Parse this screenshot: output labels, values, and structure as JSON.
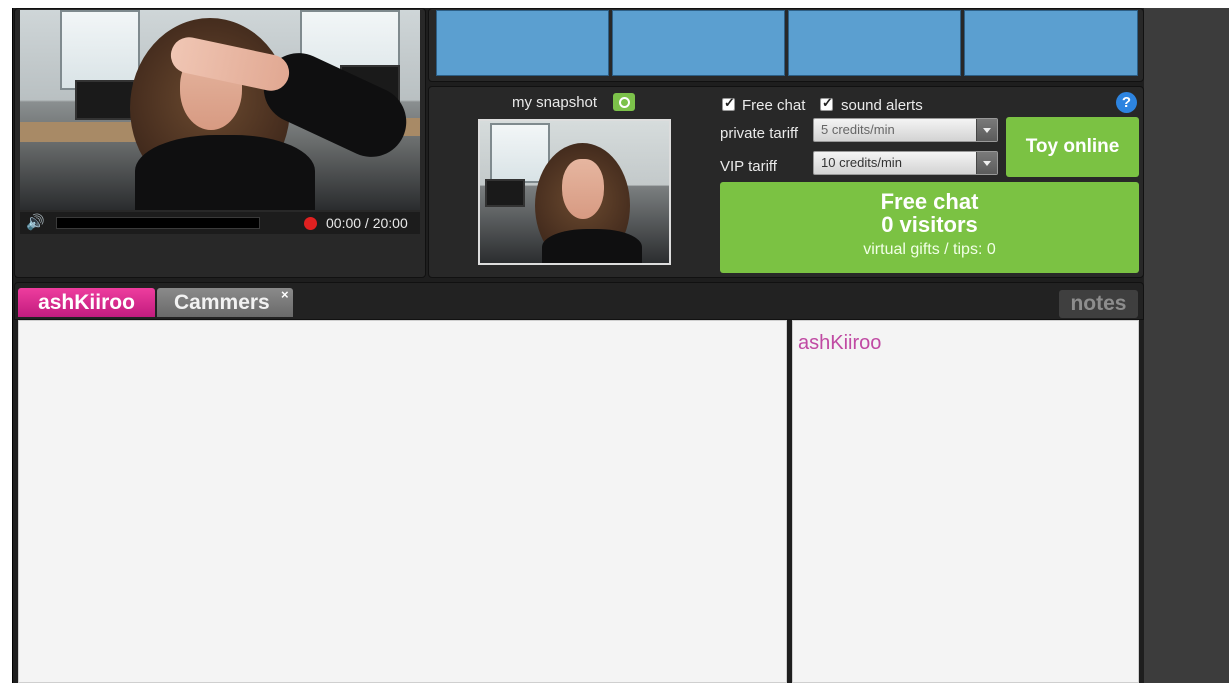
{
  "colors": {
    "accent_green": "#7bc243",
    "tab_active_pink": "#d92b8e",
    "thumb_blue": "#5b9fd0",
    "username_pink": "#c04aa3",
    "help_blue": "#2d84e0",
    "record_red": "#e02020"
  },
  "video": {
    "time": "00:00 / 20:00",
    "volume_icon": "speaker-icon",
    "record_icon": "record-dot-icon"
  },
  "snapshot": {
    "label": "my snapshot",
    "icon": "camera-icon"
  },
  "options": {
    "free_chat_label": "Free chat",
    "free_chat_checked": true,
    "sound_alerts_label": "sound alerts",
    "sound_alerts_checked": true,
    "help_icon": "?"
  },
  "tariffs": {
    "private_label": "private tariff",
    "private_value": "5 credits/min",
    "vip_label": "VIP tariff",
    "vip_value": "10 credits/min"
  },
  "buttons": {
    "toy": "Toy online",
    "free_chat_title": "Free chat",
    "free_chat_visitors": "0 visitors",
    "free_chat_gifts": "virtual gifts / tips: 0"
  },
  "tabs": {
    "active": "ashKiiroo",
    "second": "Cammers",
    "close": "×",
    "notes": "notes"
  },
  "users_list": [
    "ashKiiroo"
  ]
}
